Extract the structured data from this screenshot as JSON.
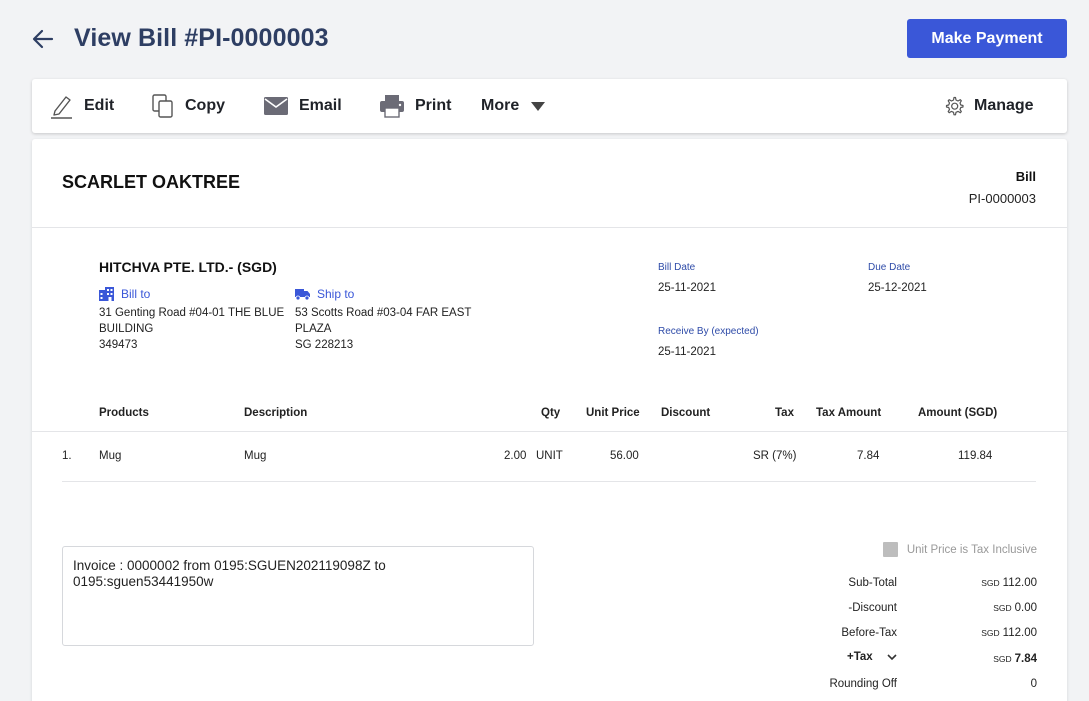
{
  "header": {
    "title": "View Bill #PI-0000003",
    "make_payment_label": "Make Payment",
    "accent_color": "#3a57d8"
  },
  "toolbar": {
    "edit_label": "Edit",
    "copy_label": "Copy",
    "email_label": "Email",
    "print_label": "Print",
    "more_label": "More",
    "manage_label": "Manage"
  },
  "bill": {
    "company_name": "SCARLET OAKTREE",
    "doc_type": "Bill",
    "doc_number": "PI-0000003",
    "vendor_name": "HITCHVA PTE. LTD.- (SGD)",
    "bill_to": {
      "label": "Bill to",
      "lines": [
        "31 Genting Road #04-01 THE BLUE",
        "BUILDING",
        "349473"
      ]
    },
    "ship_to": {
      "label": "Ship to",
      "lines": [
        "53 Scotts Road #03-04 FAR EAST",
        "PLAZA",
        "SG 228213"
      ]
    },
    "bill_date_label": "Bill Date",
    "bill_date": "25-11-2021",
    "due_date_label": "Due Date",
    "due_date": "25-12-2021",
    "receive_by_label": "Receive By (expected)",
    "receive_by": "25-11-2021"
  },
  "table": {
    "headers": {
      "products": "Products",
      "description": "Description",
      "qty": "Qty",
      "unit_price": "Unit Price",
      "discount": "Discount",
      "tax": "Tax",
      "tax_amount": "Tax Amount",
      "amount": "Amount (SGD)"
    },
    "rows": [
      {
        "index": "1.",
        "product": "Mug",
        "description": "Mug",
        "qty": "2.00",
        "unit": "UNIT",
        "unit_price": "56.00",
        "discount": "",
        "tax": "SR (7%)",
        "tax_amount": "7.84",
        "amount": "119.84"
      }
    ]
  },
  "notes": "Invoice : 0000002 from 0195:SGUEN202119098Z to 0195:sguen53441950w",
  "summary": {
    "tax_inclusive_label": "Unit Price is Tax Inclusive",
    "currency": "SGD",
    "subtotal_label": "Sub-Total",
    "subtotal": "112.00",
    "discount_label": "-Discount",
    "discount": "0.00",
    "before_tax_label": "Before-Tax",
    "before_tax": "112.00",
    "tax_label": "+Tax",
    "tax": "7.84",
    "rounding_label": "Rounding Off",
    "rounding": "0"
  }
}
